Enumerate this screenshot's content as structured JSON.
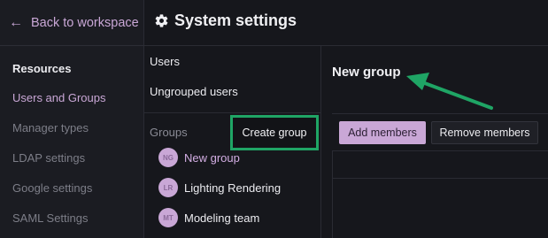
{
  "sidebar": {
    "back_label": "Back to workspace",
    "items": [
      {
        "label": "Resources"
      },
      {
        "label": "Users and Groups"
      },
      {
        "label": "Manager types"
      },
      {
        "label": "LDAP settings"
      },
      {
        "label": "Google settings"
      },
      {
        "label": "SAML Settings"
      }
    ]
  },
  "header": {
    "title": "System settings",
    "icon": "gear-icon"
  },
  "middle": {
    "users_label": "Users",
    "ungrouped_label": "Ungrouped users",
    "groups_label": "Groups",
    "create_group_label": "Create group",
    "groups": [
      {
        "initials": "NG",
        "name": "New group"
      },
      {
        "initials": "LR",
        "name": "Lighting Rendering"
      },
      {
        "initials": "MT",
        "name": "Modeling team"
      }
    ]
  },
  "panel": {
    "title": "New group",
    "add_members_label": "Add members",
    "remove_members_label": "Remove members"
  },
  "colors": {
    "accent": "#c9a7d6",
    "highlight": "#1fa565",
    "background": "#16171c"
  }
}
